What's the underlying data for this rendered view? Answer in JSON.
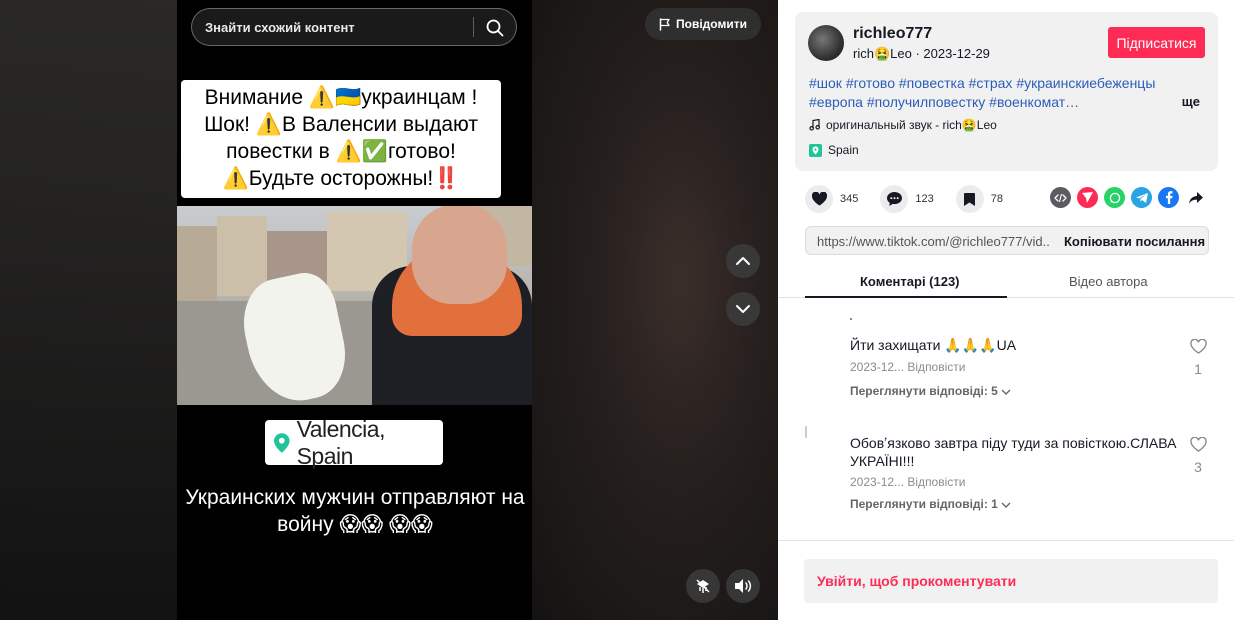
{
  "search": {
    "placeholder": "Знайти схожий контент"
  },
  "report": {
    "label": "Повідомити"
  },
  "video": {
    "caption_lines": [
      "Внимание ⚠️🇺🇦украинцам !",
      "Шок! ⚠️В Валенсии выдают",
      "повестки в ⚠️✅готово!",
      "⚠️Будьте осторожны!‼️"
    ],
    "location": "Valencia, Spain",
    "bottom_caption": "Украинских мужчин отправляют на войну 😱😱 😱😱"
  },
  "author": {
    "username": "richleo777",
    "nickname": "rich🤮Leo",
    "date": "2023-12-29",
    "follow_label": "Підписатися"
  },
  "description": {
    "tags": [
      "#шок",
      "#готово",
      "#повестка",
      "#страх",
      "#украинскиебеженцы",
      "#европа",
      "#получилповестку",
      "#военкомат…"
    ],
    "more_label": "ще",
    "sound": "оригинальный звук - rich🤮Leo",
    "place": "Spain"
  },
  "stats": {
    "likes": "345",
    "comments": "123",
    "saves": "78"
  },
  "link": {
    "url": "https://www.tiktok.com/@richleo777/vid...",
    "copy_label": "Копіювати посилання"
  },
  "tabs": {
    "comments": "Коментарі (123)",
    "videos": "Відео автора"
  },
  "comments": [
    {
      "text": "Йти захищати 🙏🙏🙏UA",
      "date": "2023-12...",
      "reply_label": "Відповісти",
      "view_replies": "Переглянути відповіді: 5",
      "likes": "1"
    },
    {
      "text": "Обовʼязково завтра піду туди за повісткою.СЛАВА УКРАЇНІ!!!",
      "date": "2023-12...",
      "reply_label": "Відповісти",
      "view_replies": "Переглянути відповіді: 1",
      "likes": "3"
    }
  ],
  "login_prompt": "Увійти, щоб прокоментувати",
  "colors": {
    "accent": "#fe2c55",
    "hashtag": "#2b5db9"
  }
}
